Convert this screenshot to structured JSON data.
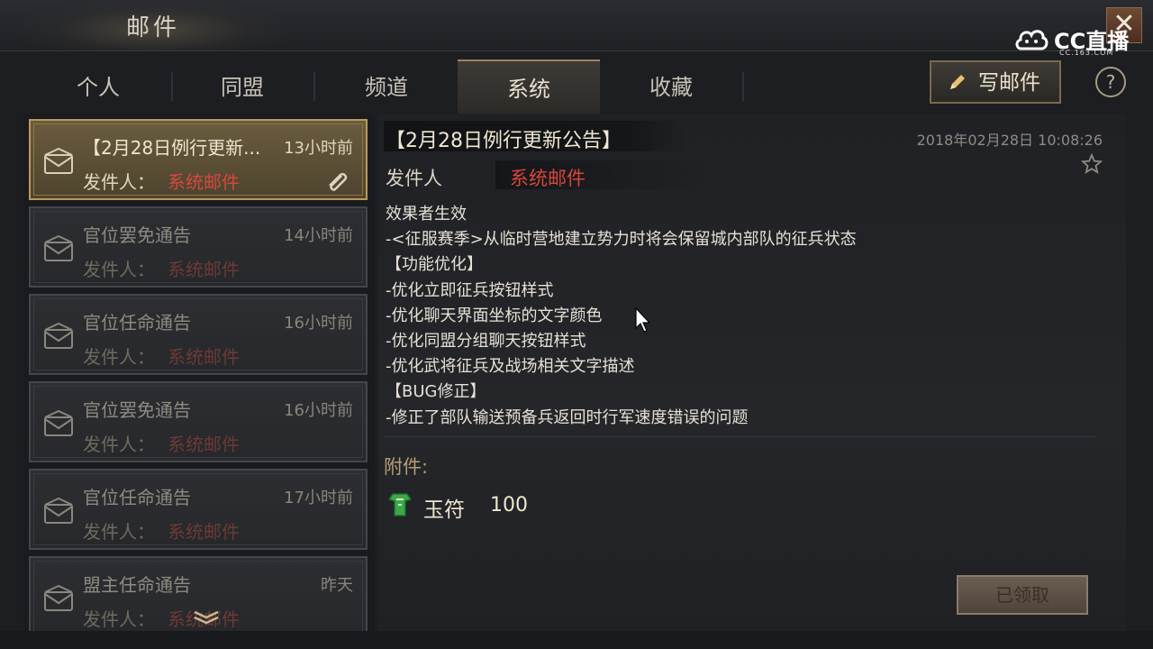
{
  "window": {
    "title": "邮件",
    "close_label": "✕"
  },
  "overlay": {
    "brand": "CC直播",
    "brand_sub": "CC.163.COM"
  },
  "tabs": [
    {
      "label": "个人",
      "active": false
    },
    {
      "label": "同盟",
      "active": false
    },
    {
      "label": "频道",
      "active": false
    },
    {
      "label": "系统",
      "active": true
    },
    {
      "label": "收藏",
      "active": false
    }
  ],
  "toolbar": {
    "compose_label": "写邮件",
    "help_label": "?"
  },
  "mail_list": [
    {
      "subject": "【2月28日例行更新...",
      "time": "13小时前",
      "sender_label": "发件人：",
      "sender": "系统邮件",
      "selected": true,
      "has_attachment": true
    },
    {
      "subject": "官位罢免通告",
      "time": "14小时前",
      "sender_label": "发件人：",
      "sender": "系统邮件",
      "selected": false,
      "has_attachment": false
    },
    {
      "subject": "官位任命通告",
      "time": "16小时前",
      "sender_label": "发件人：",
      "sender": "系统邮件",
      "selected": false,
      "has_attachment": false
    },
    {
      "subject": "官位罢免通告",
      "time": "16小时前",
      "sender_label": "发件人：",
      "sender": "系统邮件",
      "selected": false,
      "has_attachment": false
    },
    {
      "subject": "官位任命通告",
      "time": "17小时前",
      "sender_label": "发件人：",
      "sender": "系统邮件",
      "selected": false,
      "has_attachment": false
    },
    {
      "subject": "盟主任命通告",
      "time": "昨天",
      "sender_label": "发件人：",
      "sender": "系统邮件",
      "selected": false,
      "has_attachment": false
    }
  ],
  "detail": {
    "subject": "【2月28日例行更新公告】",
    "date": "2018年02月28日 10:08:26",
    "sender_label": "发件人",
    "sender": "系统邮件",
    "body": [
      "效果者生效",
      "-<征服赛季>从临时营地建立势力时将会保留城内部队的征兵状态",
      "【功能优化】",
      "-优化立即征兵按钮样式",
      "-优化聊天界面坐标的文字颜色",
      "-优化同盟分组聊天按钮样式",
      "-优化武将征兵及战场相关文字描述",
      "【BUG修正】",
      "-修正了部队输送预备兵返回时行军速度错误的问题"
    ],
    "attachment_label": "附件:",
    "attachment_item": {
      "name": "玉符",
      "qty": "100"
    },
    "claimed_label": "已领取"
  },
  "colors": {
    "accent_gold": "#c8a864",
    "sender_red": "#d5483c",
    "panel_bg": "#1f2125"
  }
}
